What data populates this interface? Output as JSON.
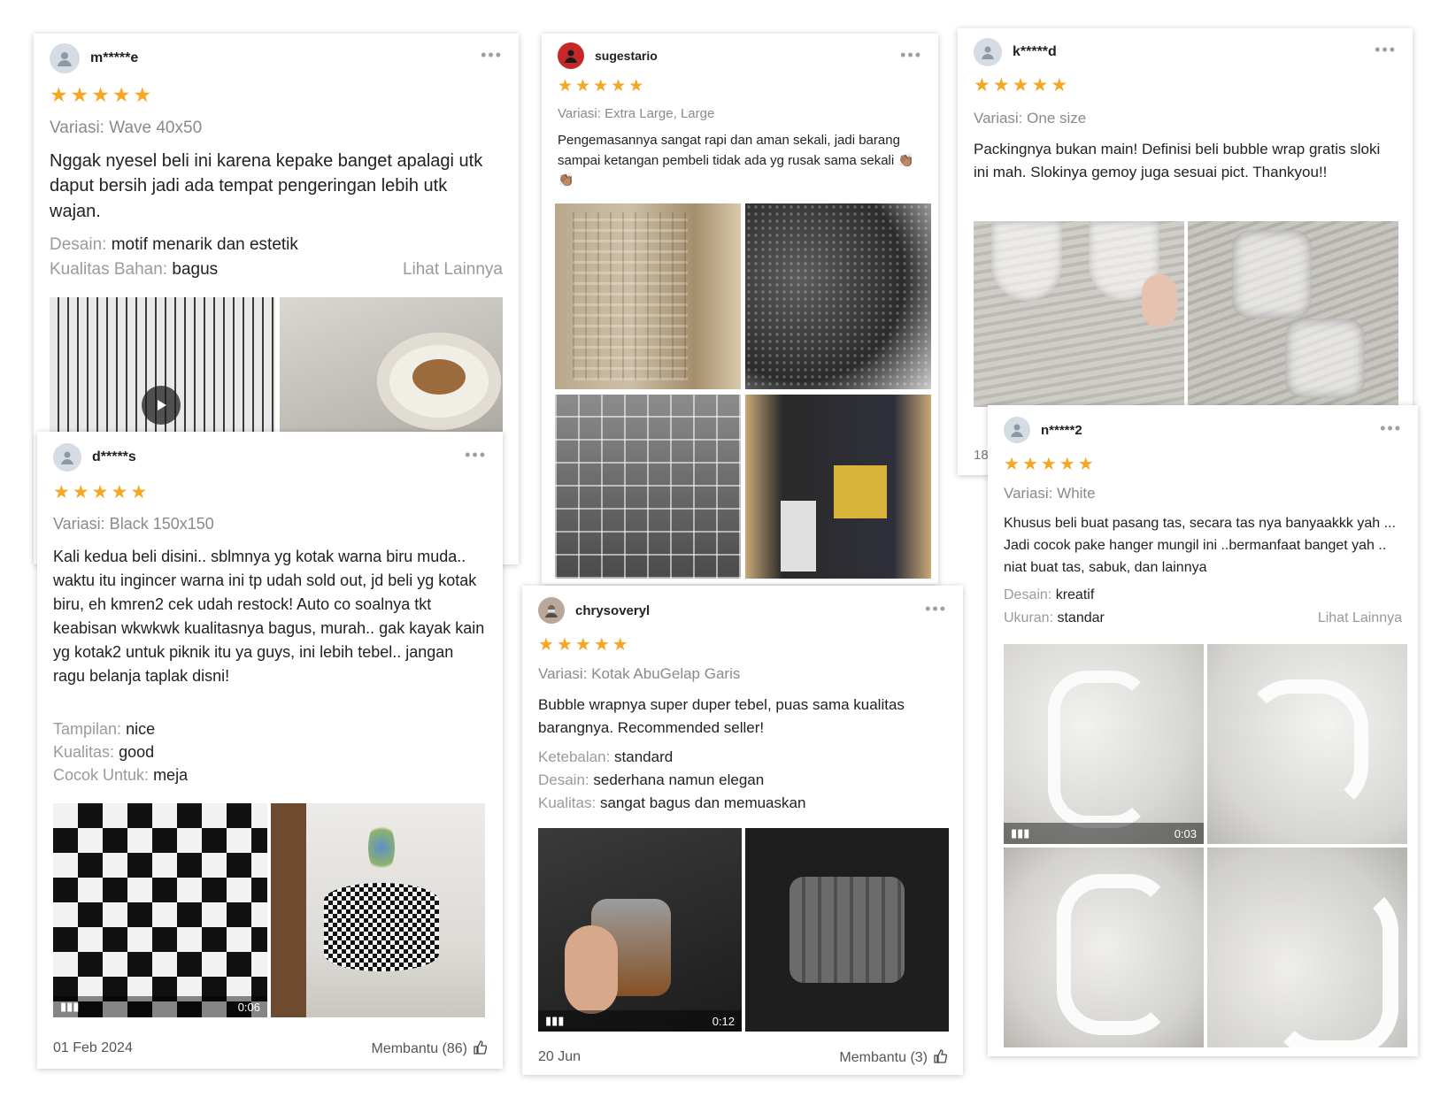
{
  "colors": {
    "star": "#f5a623",
    "muted": "#9a9a9a",
    "text": "#222222"
  },
  "icons": {
    "star": "★",
    "more": "•••"
  },
  "r1": {
    "user": "m*****e",
    "variasi": "Variasi: Wave 40x50",
    "text": "Nggak nyesel beli ini karena kepake banget apalagi utk daput bersih jadi ada tempat pengeringan lebih utk wajan.",
    "attrs": [
      {
        "k": "Desain:",
        "v": "motif menarik dan estetik"
      },
      {
        "k": "Kualitas Bahan:",
        "v": "bagus"
      }
    ],
    "lihat": "Lihat Lainnya"
  },
  "r2": {
    "user": "sugestario",
    "variasi": "Variasi: Extra Large, Large",
    "text": "Pengemasannya sangat rapi dan aman sekali, jadi barang sampai ketangan pembeli tidak ada yg rusak sama sekali 👏🏽👏🏽"
  },
  "r3": {
    "user": "k*****d",
    "variasi": "Variasi: One size",
    "text": "Packingnya bukan main! Definisi beli bubble wrap gratis sloki ini mah. Slokinya gemoy juga sesuai pict. Thankyou!!",
    "partial": "18"
  },
  "r4": {
    "user": "d*****s",
    "variasi": "Variasi: Black 150x150",
    "text": "Kali kedua beli disini.. sblmnya yg kotak warna biru muda..\nwaktu itu ingincer warna ini tp udah sold out, jd beli yg kotak biru, eh kmren2 cek udah restock! Auto co soalnya tkt keabisan wkwkwk kualitasnya bagus, murah.. gak kayak kain yg kotak2 untuk piknik itu ya guys, ini lebih tebel.. jangan ragu belanja taplak disni!",
    "attrs": [
      {
        "k": "Tampilan:",
        "v": "nice"
      },
      {
        "k": "Kualitas:",
        "v": "good"
      },
      {
        "k": "Cocok Untuk:",
        "v": "meja"
      }
    ],
    "video_time": "0:06",
    "date": "01 Feb 2024",
    "helpful": "Membantu (86)"
  },
  "r5": {
    "user": "chrysoveryl",
    "variasi": "Variasi: Kotak AbuGelap Garis",
    "text": "Bubble wrapnya super duper tebel, puas sama kualitas barangnya. Recommended seller!",
    "attrs": [
      {
        "k": "Ketebalan:",
        "v": "standard"
      },
      {
        "k": "Desain:",
        "v": "sederhana namun elegan"
      },
      {
        "k": "Kualitas:",
        "v": "sangat bagus dan memuaskan"
      }
    ],
    "video_time": "0:12",
    "date": "20 Jun",
    "helpful": "Membantu (3)"
  },
  "r6": {
    "user": "n*****2",
    "variasi": "Variasi: White",
    "text": "Khusus beli buat pasang tas, secara tas nya banyaakkk yah ... Jadi cocok pake hanger mungil ini ..bermanfaat banget yah .. niat buat tas, sabuk, dan lainnya",
    "attrs": [
      {
        "k": "Desain:",
        "v": "kreatif"
      },
      {
        "k": "Ukuran:",
        "v": "standar"
      }
    ],
    "lihat": "Lihat Lainnya",
    "video_time": "0:03"
  }
}
